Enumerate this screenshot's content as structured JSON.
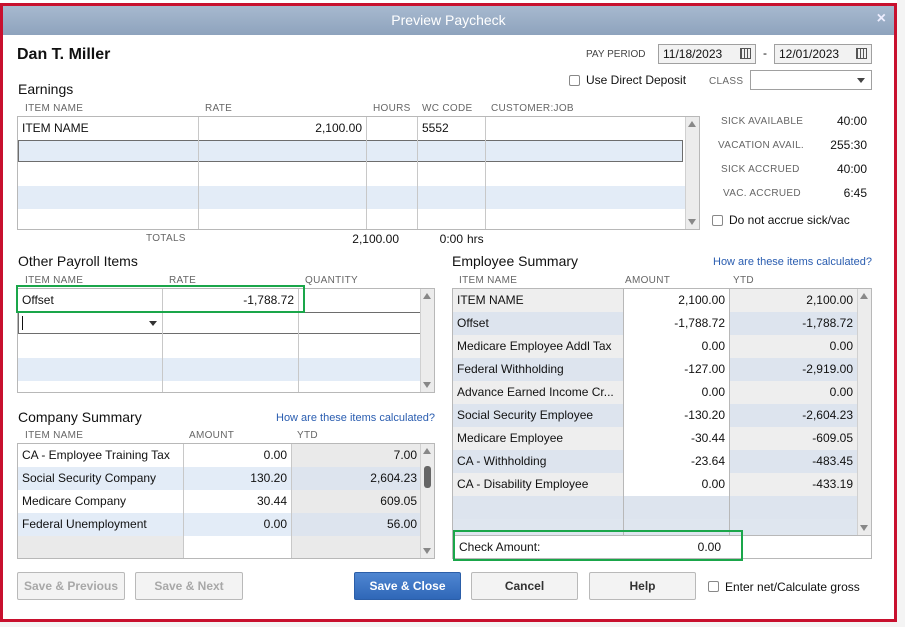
{
  "window": {
    "title": "Preview Paycheck",
    "close": "×"
  },
  "employee": {
    "name": "Dan T. Miller"
  },
  "pay_period": {
    "label": "PAY PERIOD",
    "start": "11/18/2023",
    "dash": "-",
    "end": "12/01/2023"
  },
  "direct_deposit": {
    "label": "Use Direct Deposit"
  },
  "class": {
    "label": "CLASS",
    "value": ""
  },
  "earnings": {
    "title": "Earnings",
    "headers": [
      "ITEM NAME",
      "RATE",
      "HOURS",
      "WC CODE",
      "CUSTOMER:JOB"
    ],
    "rows": [
      [
        "ITEM NAME",
        "2,100.00",
        "",
        "5552",
        ""
      ]
    ],
    "totals_label": "TOTALS",
    "total_rate": "2,100.00",
    "total_hours": "0:00",
    "hrs": "hrs"
  },
  "leave": {
    "items": [
      {
        "label": "SICK AVAILABLE",
        "value": "40:00"
      },
      {
        "label": "VACATION AVAIL.",
        "value": "255:30"
      },
      {
        "label": "SICK ACCRUED",
        "value": "40:00"
      },
      {
        "label": "VAC. ACCRUED",
        "value": "6:45"
      }
    ],
    "no_accrue_label": "Do not accrue sick/vac"
  },
  "other": {
    "title": "Other Payroll Items",
    "headers": [
      "ITEM NAME",
      "RATE",
      "QUANTITY"
    ],
    "rows": [
      [
        "Offset",
        "-1,788.72",
        ""
      ]
    ]
  },
  "company": {
    "title": "Company Summary",
    "link": "How are these items calculated?",
    "headers": [
      "ITEM NAME",
      "AMOUNT",
      "YTD"
    ],
    "rows": [
      [
        "CA - Employee Training Tax",
        "0.00",
        "7.00"
      ],
      [
        "Social Security Company",
        "130.20",
        "2,604.23"
      ],
      [
        "Medicare Company",
        "30.44",
        "609.05"
      ],
      [
        "Federal Unemployment",
        "0.00",
        "56.00"
      ]
    ]
  },
  "employee_summary": {
    "title": "Employee Summary",
    "link": "How are these items calculated?",
    "headers": [
      "ITEM NAME",
      "AMOUNT",
      "YTD"
    ],
    "rows": [
      [
        "ITEM NAME",
        "2,100.00",
        "2,100.00"
      ],
      [
        "Offset",
        "-1,788.72",
        "-1,788.72"
      ],
      [
        "Medicare Employee Addl Tax",
        "0.00",
        "0.00"
      ],
      [
        "Federal Withholding",
        "-127.00",
        "-2,919.00"
      ],
      [
        "Advance Earned Income Cr...",
        "0.00",
        "0.00"
      ],
      [
        "Social Security Employee",
        "-130.20",
        "-2,604.23"
      ],
      [
        "Medicare Employee",
        "-30.44",
        "-609.05"
      ],
      [
        "CA - Withholding",
        "-23.64",
        "-483.45"
      ],
      [
        "CA - Disability Employee",
        "0.00",
        "-433.19"
      ]
    ],
    "check_label": "Check Amount:",
    "check_value": "0.00"
  },
  "buttons": {
    "save_prev": "Save & Previous",
    "save_next": "Save & Next",
    "save_close": "Save & Close",
    "cancel": "Cancel",
    "help": "Help"
  },
  "net_gross": {
    "label": "Enter net/Calculate gross"
  }
}
